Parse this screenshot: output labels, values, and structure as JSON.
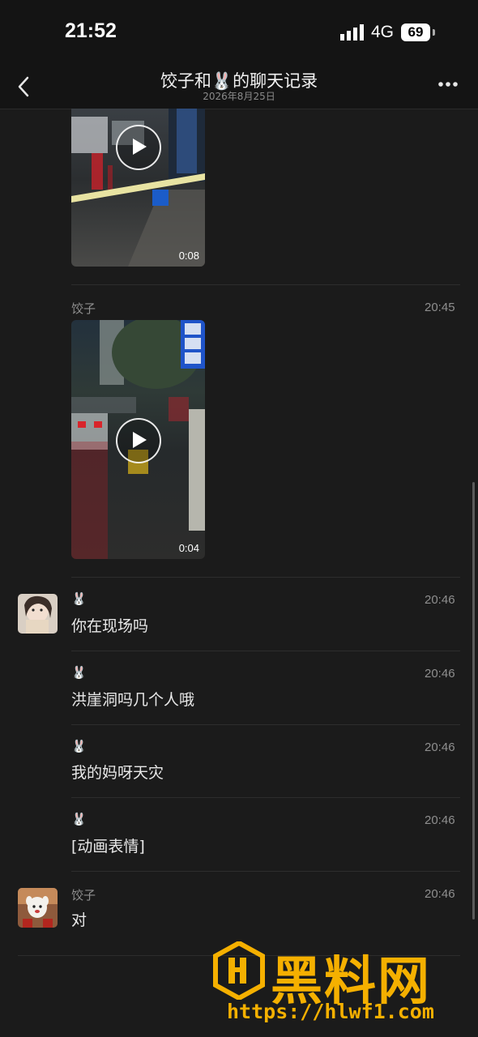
{
  "status_bar": {
    "time": "21:52",
    "network": "4G",
    "battery": "69"
  },
  "nav": {
    "title": "饺子和🐰的聊天记录",
    "subtitle": "2026年8月25日"
  },
  "videos": [
    {
      "duration": "0:08"
    },
    {
      "duration": "0:04"
    }
  ],
  "messages": [
    {
      "sender": "饺子",
      "time": "20:45"
    },
    {
      "sender": "🐰",
      "time": "20:46",
      "text": "你在现场吗"
    },
    {
      "sender": "🐰",
      "time": "20:46",
      "text": "洪崖洞吗几个人哦"
    },
    {
      "sender": "🐰",
      "time": "20:46",
      "text": "我的妈呀天灾"
    },
    {
      "sender": "🐰",
      "time": "20:46",
      "text": "[动画表情]"
    },
    {
      "sender": "饺子",
      "time": "20:46",
      "text": "对"
    }
  ],
  "watermark": {
    "title": "黑料网",
    "url": "https://hlwf1.com"
  },
  "icons": {
    "back": "chevron-left-icon",
    "more": "more-dots-icon",
    "play": "play-icon",
    "signal": "signal-icon",
    "battery": "battery-icon"
  }
}
